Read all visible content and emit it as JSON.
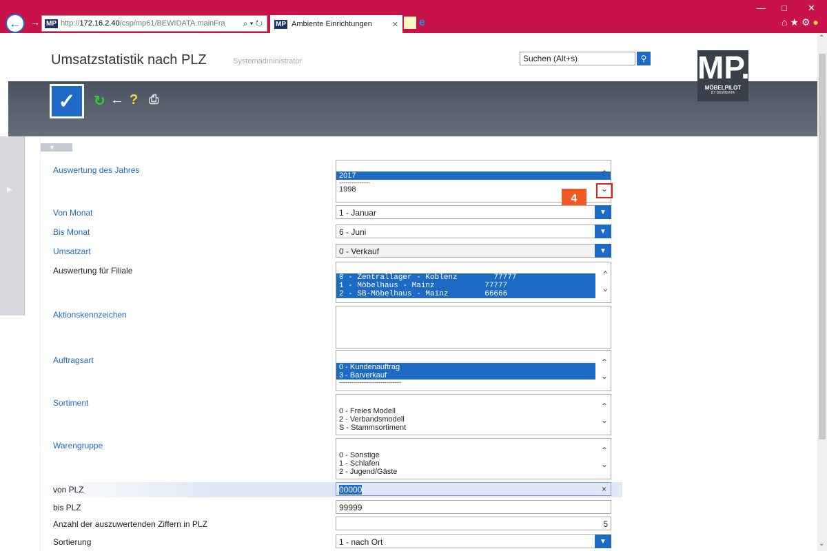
{
  "browser": {
    "url_prefix": "http://",
    "url_host": "172.16.2.40",
    "url_path": "/csp/mp61/BEWIDATA.mainFra",
    "url_controls": "⌕ ▾ ↻",
    "tab_title": "Ambiente Einrichtungen",
    "favicon_text": "MP"
  },
  "page": {
    "title": "Umsatzstatistik nach PLZ",
    "subtitle": "Systemadministrator",
    "search_placeholder": "Suchen (Alt+s)"
  },
  "logo": {
    "big": "MP.",
    "small": "MÖBELPILOT",
    "tiny": "BY BEWIDATA"
  },
  "callout": "4",
  "fields": {
    "jahr_label": "Auswertung des Jahres",
    "jahr_options": [
      "2017",
      "---------------",
      "1998"
    ],
    "von_monat_label": "Von Monat",
    "von_monat_value": "1 - Januar",
    "bis_monat_label": "Bis Monat",
    "bis_monat_value": "6 - Juni",
    "umsatzart_label": "Umsatzart",
    "umsatzart_value": "0 - Verkauf",
    "filiale_label": "Auswertung für Filiale",
    "filiale_options": [
      "0 - Zentrallager - Koblenz        77777",
      "1 - Möbelhaus - Mainz           77777",
      "2 - SB-Möbelhaus - Mainz        66666"
    ],
    "aktion_label": "Aktionskennzeichen",
    "auftragsart_label": "Auftragsart",
    "auftragsart_options": [
      "0 - Kundenauftrag",
      "3 - Barverkauf",
      "------------------------------"
    ],
    "sortiment_label": "Sortiment",
    "sortiment_options": [
      "0 - Freies Modell",
      "2 - Verbandsmodell",
      "S - Stammsortiment"
    ],
    "warengruppe_label": "Warengruppe",
    "warengruppe_options": [
      "0 - Sonstige",
      "1 - Schlafen",
      "2 - Jugend/Gäste"
    ],
    "von_plz_label": "von PLZ",
    "von_plz_value": "00000",
    "bis_plz_label": "bis PLZ",
    "bis_plz_value": "99999",
    "ziffern_label": "Anzahl der auszuwertenden Ziffern in PLZ",
    "ziffern_value": "5",
    "sortierung_label": "Sortierung",
    "sortierung_value": "1 - nach Ort"
  }
}
